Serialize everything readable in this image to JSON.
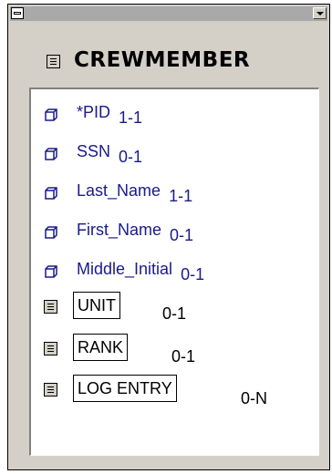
{
  "entity": {
    "title": "CREWMEMBER",
    "icon": "entity-table-icon"
  },
  "attributes": [
    {
      "name": "*PID",
      "cardinality": "1-1",
      "icon": "attribute-icon"
    },
    {
      "name": "SSN",
      "cardinality": "0-1",
      "icon": "attribute-icon"
    },
    {
      "name": "Last_Name",
      "cardinality": "1-1",
      "icon": "attribute-icon"
    },
    {
      "name": "First_Name",
      "cardinality": "0-1",
      "icon": "attribute-icon"
    },
    {
      "name": "Middle_Initial",
      "cardinality": "0-1",
      "icon": "attribute-icon"
    }
  ],
  "relationships": [
    {
      "name": "UNIT",
      "cardinality": "0-1",
      "icon": "entity-table-icon"
    },
    {
      "name": "RANK",
      "cardinality": "0-1",
      "icon": "entity-table-icon"
    },
    {
      "name": "LOG ENTRY",
      "cardinality": "0-N",
      "icon": "entity-table-icon"
    }
  ],
  "colors": {
    "window_bg": "#d4d0c8",
    "titlebar": "#a9a9a9",
    "attribute_text": "#1a1a8c",
    "relationship_text": "#000000"
  }
}
